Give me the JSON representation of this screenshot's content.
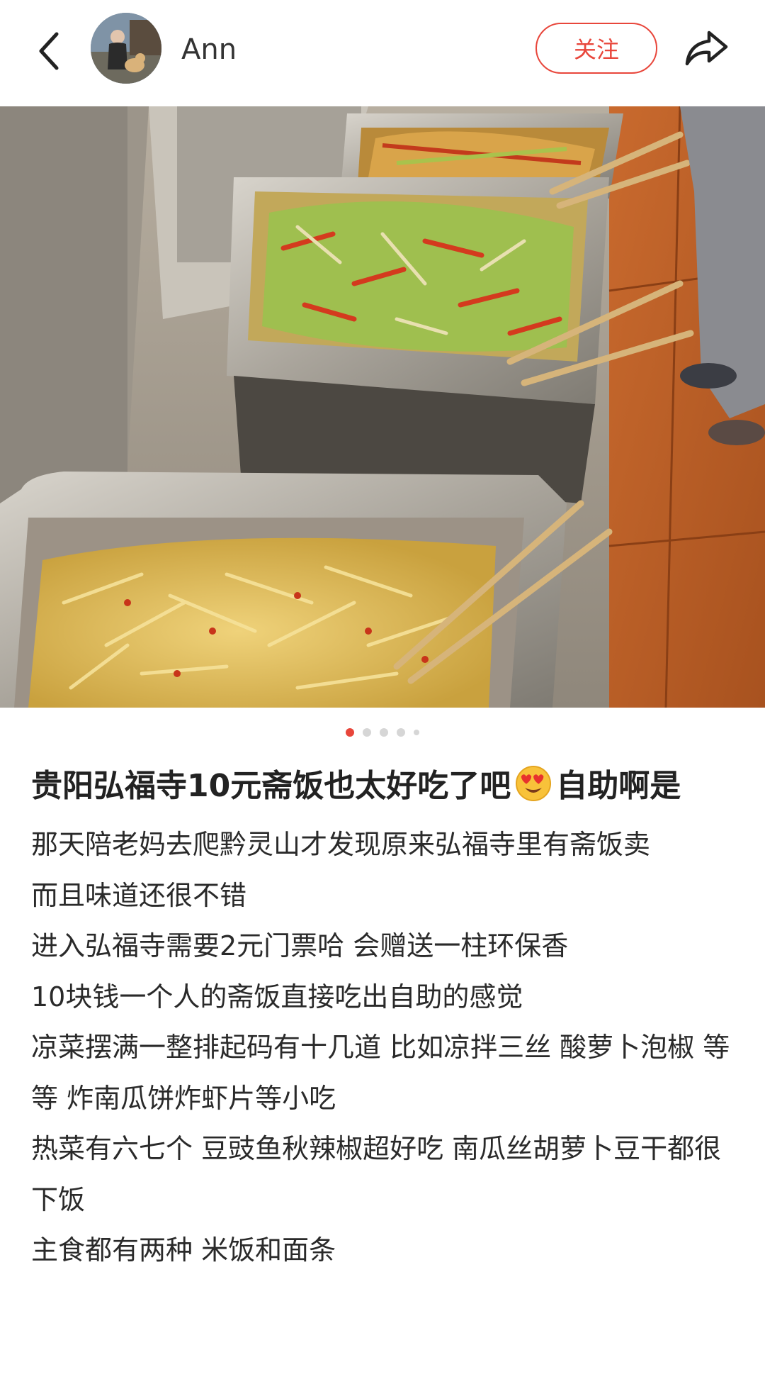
{
  "header": {
    "author": "Ann",
    "follow_label": "关注",
    "back_icon": "chevron-left-icon",
    "share_icon": "share-arrow-icon"
  },
  "carousel": {
    "total": 5,
    "active_index": 0
  },
  "post": {
    "title_before_emoji": "贵阳弘福寺10元斋饭也太好吃了吧",
    "emoji": "heart-eyes-emoji",
    "title_after_emoji": "自助啊是",
    "body": [
      "那天陪老妈去爬黔灵山才发现原来弘福寺里有斋饭卖",
      "而且味道还很不错",
      "进入弘福寺需要2元门票哈 会赠送一柱环保香",
      "10块钱一个人的斋饭直接吃出自助的感觉",
      "凉菜摆满一整排起码有十几道 比如凉拌三丝 酸萝卜泡椒 等等 炸南瓜饼炸虾片等小吃",
      "热菜有六七个 豆豉鱼秋辣椒超好吃 南瓜丝胡萝卜豆干都很下饭",
      "主食都有两种 米饭和面条"
    ]
  },
  "colors": {
    "accent": "#e8463b",
    "text": "#222222",
    "dot_inactive": "#d6d6d6"
  }
}
